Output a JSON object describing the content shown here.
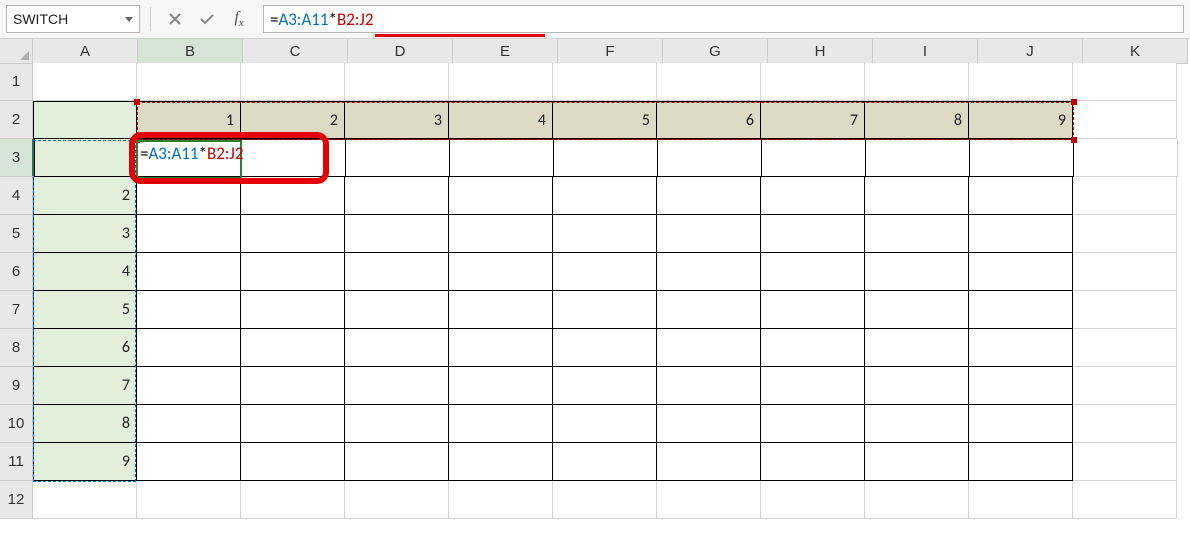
{
  "namebox": {
    "value": "SWITCH"
  },
  "formula_bar": {
    "eq": "=",
    "range1": "A3:A11",
    "op": "*",
    "range2": "B2:J2"
  },
  "cell_edit": {
    "eq": "=",
    "range1": "A3:A11",
    "op": "*",
    "range2": "B2:J2"
  },
  "columns": [
    "A",
    "B",
    "C",
    "D",
    "E",
    "F",
    "G",
    "H",
    "I",
    "J",
    "K"
  ],
  "row_headers": [
    "1",
    "2",
    "3",
    "4",
    "5",
    "6",
    "7",
    "8",
    "9",
    "10",
    "11",
    "12"
  ],
  "row2_values": [
    "",
    "1",
    "2",
    "3",
    "4",
    "5",
    "6",
    "7",
    "8",
    "9",
    ""
  ],
  "colA_values": {
    "3": "",
    "4": "2",
    "5": "3",
    "6": "4",
    "7": "5",
    "8": "6",
    "9": "7",
    "10": "8",
    "11": "9"
  },
  "icons": {
    "cancel": "✕",
    "enter": "✓"
  }
}
